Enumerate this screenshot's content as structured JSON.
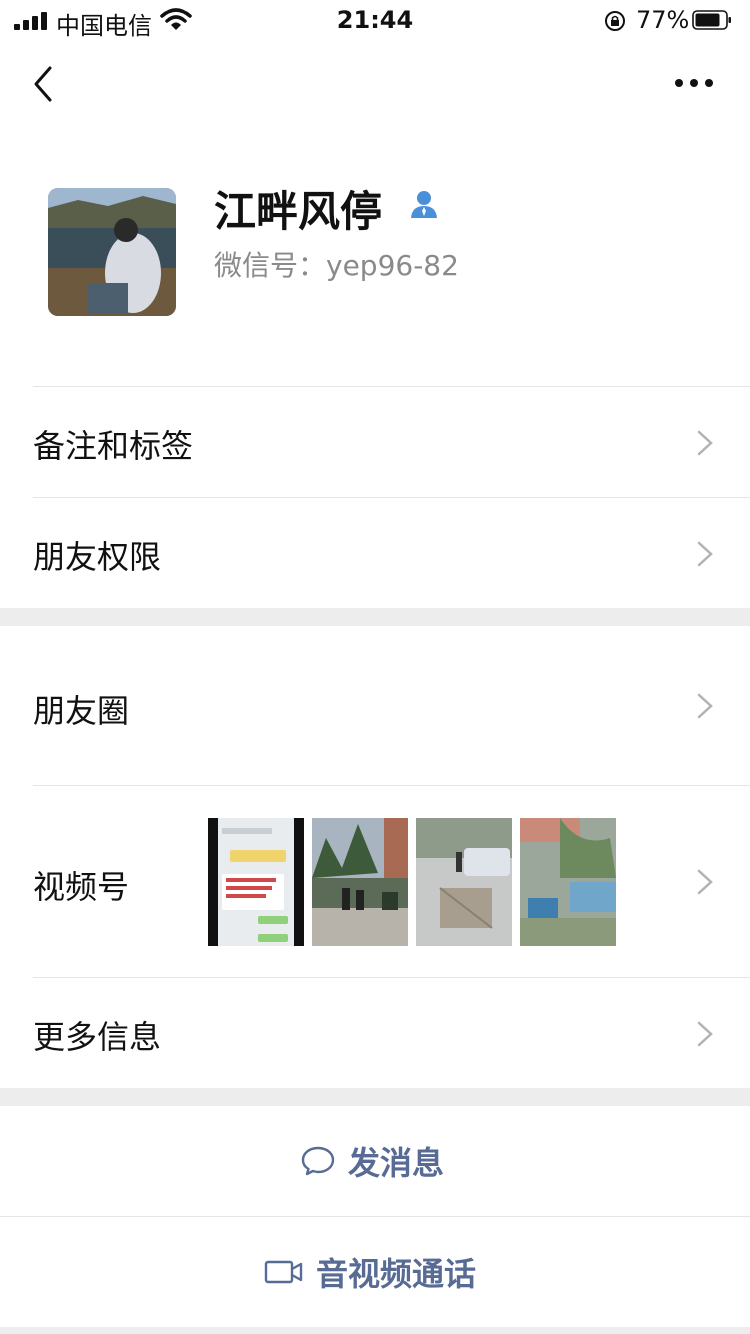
{
  "status_bar": {
    "carrier": "中国电信",
    "time": "21:44",
    "battery_percent": "77%"
  },
  "nav": {
    "back_icon": "chevron-left-icon",
    "more_icon": "more-dots-icon"
  },
  "profile": {
    "nickname": "江畔风停",
    "wechat_id": "微信号：yep96-82",
    "contact_icon": "user-icon"
  },
  "menu": {
    "remarks_tags": "备注和标签",
    "friend_permissions": "朋友权限",
    "moments": "朋友圈",
    "channels": "视频号",
    "more_info": "更多信息"
  },
  "actions": {
    "send_message": "发消息",
    "video_call": "音视频通话"
  },
  "colors": {
    "link_blue": "#576b95",
    "section_gap": "#ededed",
    "secondary_text": "#8a8a8a"
  }
}
